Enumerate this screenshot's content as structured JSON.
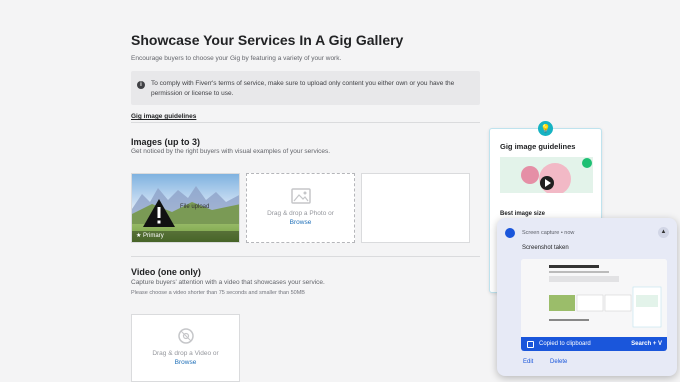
{
  "header": {
    "title": "Showcase Your Services In A Gig Gallery",
    "subtitle": "Encourage buyers to choose your Gig by featuring a variety of your work."
  },
  "notice": {
    "text": "To comply with Fiverr's terms of service, make sure to upload only content you either own or you have the permission or license to use."
  },
  "guidelines_link": "Gig image guidelines",
  "images": {
    "title": "Images (up to 3)",
    "subtitle": "Get noticed by the right buyers with visual examples of your services.",
    "tile1": {
      "upload_text": "File upload",
      "primary_label": "Primary"
    },
    "dropzone": {
      "text": "Drag & drop a Photo or",
      "link": "Browse"
    }
  },
  "video": {
    "title": "Video (one only)",
    "subtitle": "Capture buyers' attention with a video that showcases your service.",
    "note": "Please choose a video shorter than 75 seconds and smaller than 50MB",
    "dropzone": {
      "text": "Drag & drop a Video or",
      "link": "Browse"
    }
  },
  "side_card": {
    "title": "Gig image guidelines",
    "subtitle": "Best image size"
  },
  "notification": {
    "app": "Screen capture • now",
    "message": "Screenshot taken",
    "clipboard": "Copied to clipboard",
    "shortcut": "Search + V",
    "edit": "Edit",
    "delete": "Delete"
  },
  "colors": {
    "link": "#1f6fb8",
    "accent": "#1a56db",
    "teal": "#16b3c2"
  }
}
